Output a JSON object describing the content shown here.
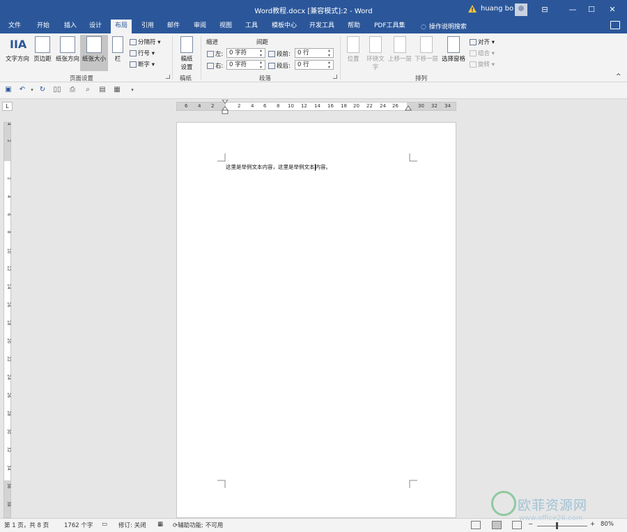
{
  "title_bar": {
    "title": "Word教程.docx [兼容模式]:2  -  Word",
    "user": "huang bo",
    "window_buttons": [
      "restore-ribbon-icon",
      "minimize-icon",
      "maximize-icon",
      "close-icon"
    ]
  },
  "tabs": [
    "文件",
    "开始",
    "插入",
    "设计",
    "布局",
    "引用",
    "邮件",
    "审阅",
    "视图",
    "工具",
    "模板中心",
    "开发工具",
    "帮助",
    "PDF工具集"
  ],
  "active_tab": "布局",
  "tell_me": "操作说明搜索",
  "ribbon": {
    "page_setup": {
      "group_label": "页面设置",
      "text_direction": "文字方向",
      "margins": "页边距",
      "orientation": "纸张方向",
      "size": "纸张大小",
      "columns": "栏",
      "breaks": "分隔符",
      "line_numbers": "行号",
      "hyphenation": "断字"
    },
    "draft": {
      "group_label": "稿纸",
      "draft_settings_line1": "稿纸",
      "draft_settings_line2": "设置"
    },
    "paragraph": {
      "group_label": "段落",
      "indent_label": "缩进",
      "spacing_label": "间距",
      "left_label": "左:",
      "left_value": "0 字符",
      "right_label": "右:",
      "right_value": "0 字符",
      "before_label": "段前:",
      "before_value": "0 行",
      "after_label": "段后:",
      "after_value": "0 行"
    },
    "arrange": {
      "group_label": "排列",
      "position": "位置",
      "wrap_text_line1": "环绕文",
      "wrap_text_line2": "字",
      "bring_forward": "上移一层",
      "send_backward": "下移一层",
      "selection_pane": "选择窗格",
      "align": "对齐",
      "group": "组合",
      "rotate": "旋转"
    }
  },
  "ruler": {
    "corner": "L",
    "h_ticks": [
      "6",
      "4",
      "2",
      "2",
      "4",
      "6",
      "8",
      "10",
      "12",
      "14",
      "16",
      "18",
      "20",
      "22",
      "24",
      "26",
      "30",
      "32",
      "34"
    ],
    "v_ticks": [
      "4",
      "2",
      "2",
      "4",
      "6",
      "8",
      "10",
      "12",
      "14",
      "16",
      "18",
      "20",
      "22",
      "24",
      "26",
      "28",
      "30",
      "32",
      "34",
      "36",
      "38"
    ]
  },
  "document": {
    "text_before_caret": "这里是举例文本内容，这里是举例文本",
    "text_after_caret": "内容。"
  },
  "status_bar": {
    "page": "第 1 页，共 8 页",
    "words": "1762 个字",
    "track_changes": "修订: 关闭",
    "accessibility": "辅助功能: 不可用",
    "zoom": "80%",
    "zoom_minus": "−",
    "zoom_plus": "+"
  },
  "watermark": {
    "text": "欧菲资源网",
    "url": "www.office26.com"
  }
}
